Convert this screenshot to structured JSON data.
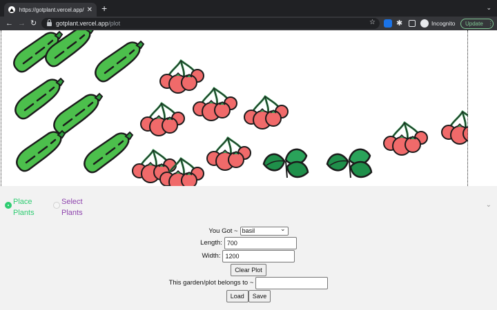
{
  "browser": {
    "tab_title": "https://gotplant.vercel.app/pl",
    "tab_close": "✕",
    "new_tab": "+",
    "url_host": "gotplant.vercel.app",
    "url_path": "/plot",
    "incognito_label": "Incognito",
    "update_label": "Update"
  },
  "plot": {
    "plants": [
      "zucchini",
      "cherry-tomato",
      "basil"
    ]
  },
  "controls": {
    "mode_place": "Place Plants",
    "mode_select": "Select Plants",
    "selected_mode": "place",
    "you_got_label": "You Got ~",
    "you_got_value": "basil",
    "length_label": "Length:",
    "length_value": "700",
    "width_label": "Width:",
    "width_value": "1200",
    "clear_plot": "Clear Plot",
    "owner_label": "This garden/plot belongs to ~",
    "owner_value": "",
    "load": "Load",
    "save": "Save"
  },
  "colors": {
    "accent_green": "#2ecc71",
    "accent_purple": "#8e44ad",
    "zucchini": "#4cbf4c",
    "tomato": "#f06a6a",
    "basil": "#1f8f4a"
  }
}
